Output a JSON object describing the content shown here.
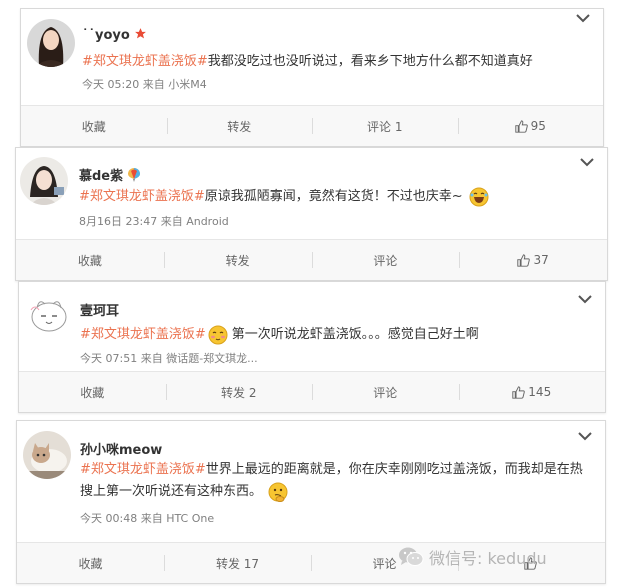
{
  "posts": [
    {
      "username": "˙˙yoyo",
      "hashtag": "#郑文琪龙虾盖浇饭#",
      "text": "我都没吃过也没听说过，看来乡下地方什么都不知道真好",
      "time": "今天 05:20",
      "source_prefix": "来自",
      "source": "小米M4",
      "actions": {
        "favorite": "收藏",
        "repost": "转发",
        "comment": "评论 1",
        "like": "95"
      }
    },
    {
      "username": "慕de紫",
      "hashtag": "#郑文琪龙虾盖浇饭#",
      "text": "原谅我孤陋寡闻，竟然有这货！不过也庆幸~",
      "time": "8月16日 23:47",
      "source_prefix": "来自",
      "source": "Android",
      "actions": {
        "favorite": "收藏",
        "repost": "转发",
        "comment": "评论",
        "like": "37"
      }
    },
    {
      "username": "壹珂耳",
      "hashtag": "#郑文琪龙虾盖浇饭#",
      "text": "第一次听说龙虾盖浇饭。。。感觉自己好土啊",
      "time": "今天 07:51",
      "source_prefix": "来自",
      "source": "微话题-郑文琪龙...",
      "actions": {
        "favorite": "收藏",
        "repost": "转发 2",
        "comment": "评论",
        "like": "145"
      }
    },
    {
      "username": "孙小咪meow",
      "hashtag": "#郑文琪龙虾盖浇饭#",
      "text": "世界上最远的距离就是，你在庆幸刚刚吃过盖浇饭，而我却是在热搜上第一次听说还有这种东西。",
      "time": "今天 00:48",
      "source_prefix": "来自",
      "source": "HTC One",
      "actions": {
        "favorite": "收藏",
        "repost": "转发 17",
        "comment": "评论",
        "like": ""
      }
    }
  ],
  "watermark": {
    "text": "微信号: kedudu"
  },
  "colors": {
    "hashtag": "#eb7350",
    "meta": "#808080",
    "badge": "#e94b35"
  }
}
